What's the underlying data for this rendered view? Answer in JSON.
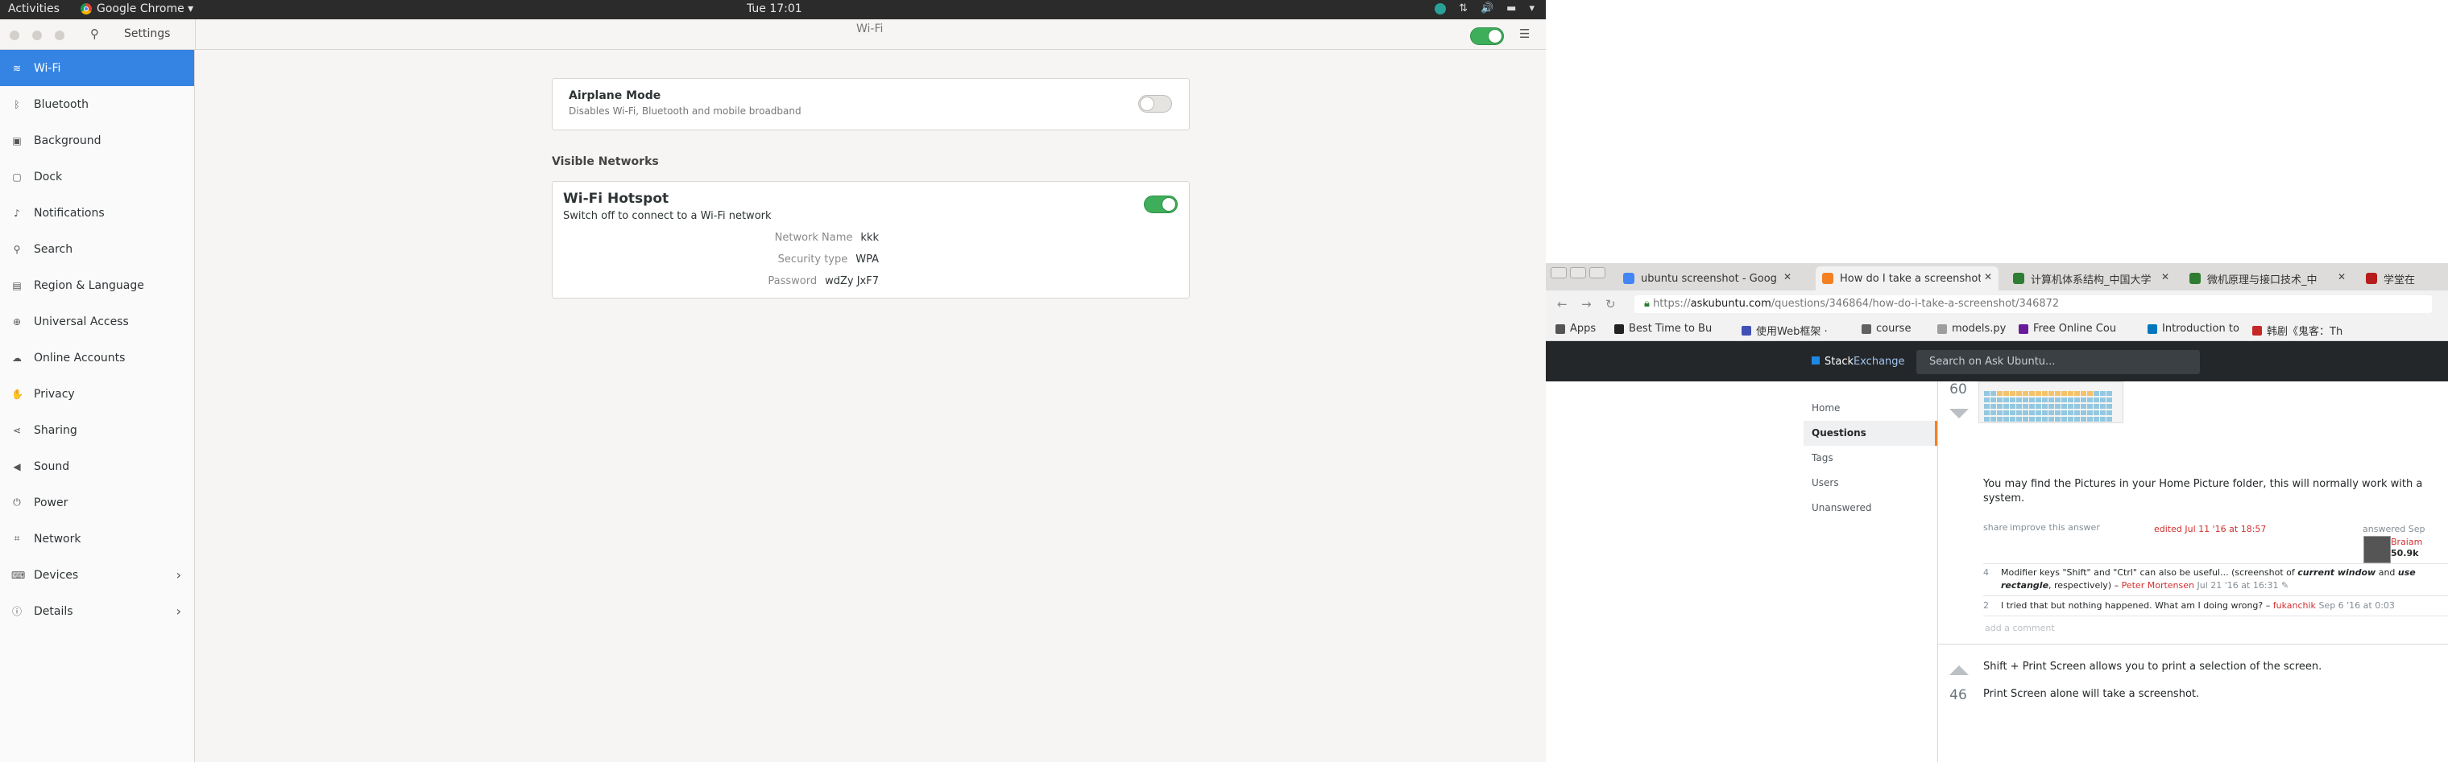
{
  "topbar": {
    "activities": "Activities",
    "app": "Google Chrome ▾",
    "clock": "Tue 17:01"
  },
  "settings": {
    "search_label": "Settings",
    "page_title": "Wi-Fi",
    "sidebar": [
      {
        "label": "Wi-Fi",
        "icon": "wifi-icon"
      },
      {
        "label": "Bluetooth",
        "icon": "bluetooth-icon"
      },
      {
        "label": "Background",
        "icon": "background-icon"
      },
      {
        "label": "Dock",
        "icon": "dock-icon"
      },
      {
        "label": "Notifications",
        "icon": "bell-icon"
      },
      {
        "label": "Search",
        "icon": "search-icon"
      },
      {
        "label": "Region & Language",
        "icon": "camera-icon"
      },
      {
        "label": "Universal Access",
        "icon": "accessibility-icon"
      },
      {
        "label": "Online Accounts",
        "icon": "cloud-icon"
      },
      {
        "label": "Privacy",
        "icon": "hand-icon"
      },
      {
        "label": "Sharing",
        "icon": "share-icon"
      },
      {
        "label": "Sound",
        "icon": "speaker-icon"
      },
      {
        "label": "Power",
        "icon": "power-icon"
      },
      {
        "label": "Network",
        "icon": "network-icon"
      },
      {
        "label": "Devices",
        "icon": "devices-icon"
      },
      {
        "label": "Details",
        "icon": "info-icon"
      }
    ],
    "airplane": {
      "title": "Airplane Mode",
      "subtitle": "Disables Wi-Fi, Bluetooth and mobile broadband",
      "enabled": false
    },
    "visible_networks_title": "Visible Networks",
    "hotspot": {
      "title": "Wi-Fi Hotspot",
      "subtitle": "Switch off to connect to a Wi-Fi network",
      "enabled": true,
      "network_name_label": "Network Name",
      "network_name": "kkk",
      "security_label": "Security type",
      "security": "WPA",
      "password_label": "Password",
      "password": "wdZy JxF7"
    },
    "wifi_enabled": true,
    "accent_color": "#3584e4"
  },
  "browser": {
    "tabs": [
      {
        "title": "ubuntu screenshot - Goog",
        "color": "#4285f4"
      },
      {
        "title": "How do I take a screenshot",
        "color": "#f48024"
      },
      {
        "title": "计算机体系结构_中国大学",
        "color": "#2e7d32"
      },
      {
        "title": "微机原理与接口技术_中",
        "color": "#2e7d32"
      },
      {
        "title": "学堂在",
        "color": "#b71c1c"
      }
    ],
    "url_base": "https://",
    "url_host": "askubuntu.com",
    "url_path": "/questions/346864/how-do-i-take-a-screenshot/346872",
    "bookmarks": [
      {
        "label": "Apps",
        "color": "#555"
      },
      {
        "label": "Best Time to Bu",
        "color": "#222"
      },
      {
        "label": "使用Web框架 ·",
        "color": "#3f51b5"
      },
      {
        "label": "course",
        "color": "#616161"
      },
      {
        "label": "models.py",
        "color": "#9e9e9e"
      },
      {
        "label": "Free Online Cou",
        "color": "#6a1b9a"
      },
      {
        "label": "Introduction to",
        "color": "#0277bd"
      },
      {
        "label": "韩剧《鬼客：Th",
        "color": "#c62828"
      }
    ],
    "site": {
      "logo_stack": "Stack",
      "logo_exchange": "Exchange",
      "search_placeholder": "Search on Ask Ubuntu...",
      "nav": [
        "Home",
        "Questions",
        "Tags",
        "Users",
        "Unanswered"
      ],
      "answer1": {
        "votes": "60",
        "text_line1": "You may find the Pictures in your Home Picture folder, this will normally work with a",
        "text_line2": "system.",
        "share": "share",
        "improve": "improve this answer",
        "edited": "edited Jul 11 '16 at 18:57",
        "answered": "answered Sep",
        "user": "Braiam",
        "rep": "50.9k",
        "comments": [
          {
            "votes": "4",
            "text": "Modifier keys \"Shift\" and \"Ctrl\" can also be useful... (screenshot of",
            "bold": "current window",
            "after": "and",
            "bold2": "use",
            "line2_bold": "rectangle",
            "line2": ", respectively) –",
            "user": "Peter Mortensen",
            "date": "Jul 21 '16 at 16:31 ✎"
          },
          {
            "votes": "2",
            "text": "I tried that but nothing happened. What am I doing wrong? –",
            "user": "fukanchik",
            "date": "Sep 6 '16 at 0:03"
          }
        ],
        "add_comment": "add a comment"
      },
      "answer2": {
        "votes": "46",
        "line1": "Shift + Print Screen allows you to print a selection of the screen.",
        "line2": "Print Screen alone will take a screenshot."
      }
    }
  }
}
